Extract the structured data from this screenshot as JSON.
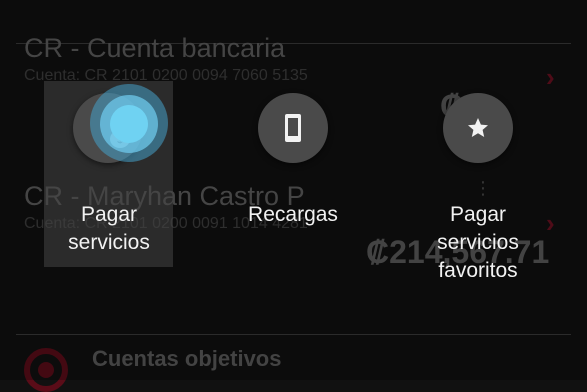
{
  "accounts": [
    {
      "title": "CR - Cuenta bancaria",
      "number": "Cuenta: CR 2101 0200 0094 7060 5135",
      "balance": "₡"
    },
    {
      "title": "CR - Maryhan Castro P",
      "number": "Cuenta: CR 2101 0200 0091 1014 4281",
      "balance": "₡214,567.71"
    }
  ],
  "goals_section": {
    "title": "Cuentas objetivos"
  },
  "actions": [
    {
      "label_line1": "Pagar",
      "label_line2": "servicios",
      "icon": "money-bag-icon"
    },
    {
      "label": "Recargas",
      "icon": "phone-icon"
    },
    {
      "label_line1": "Pagar",
      "label_line2": "servicios",
      "label_line3": "favoritos",
      "icon": "star-icon"
    }
  ],
  "colors": {
    "accent": "#6a1020",
    "fab": "#4a4a4a",
    "ripple": "#6fd2f2"
  }
}
